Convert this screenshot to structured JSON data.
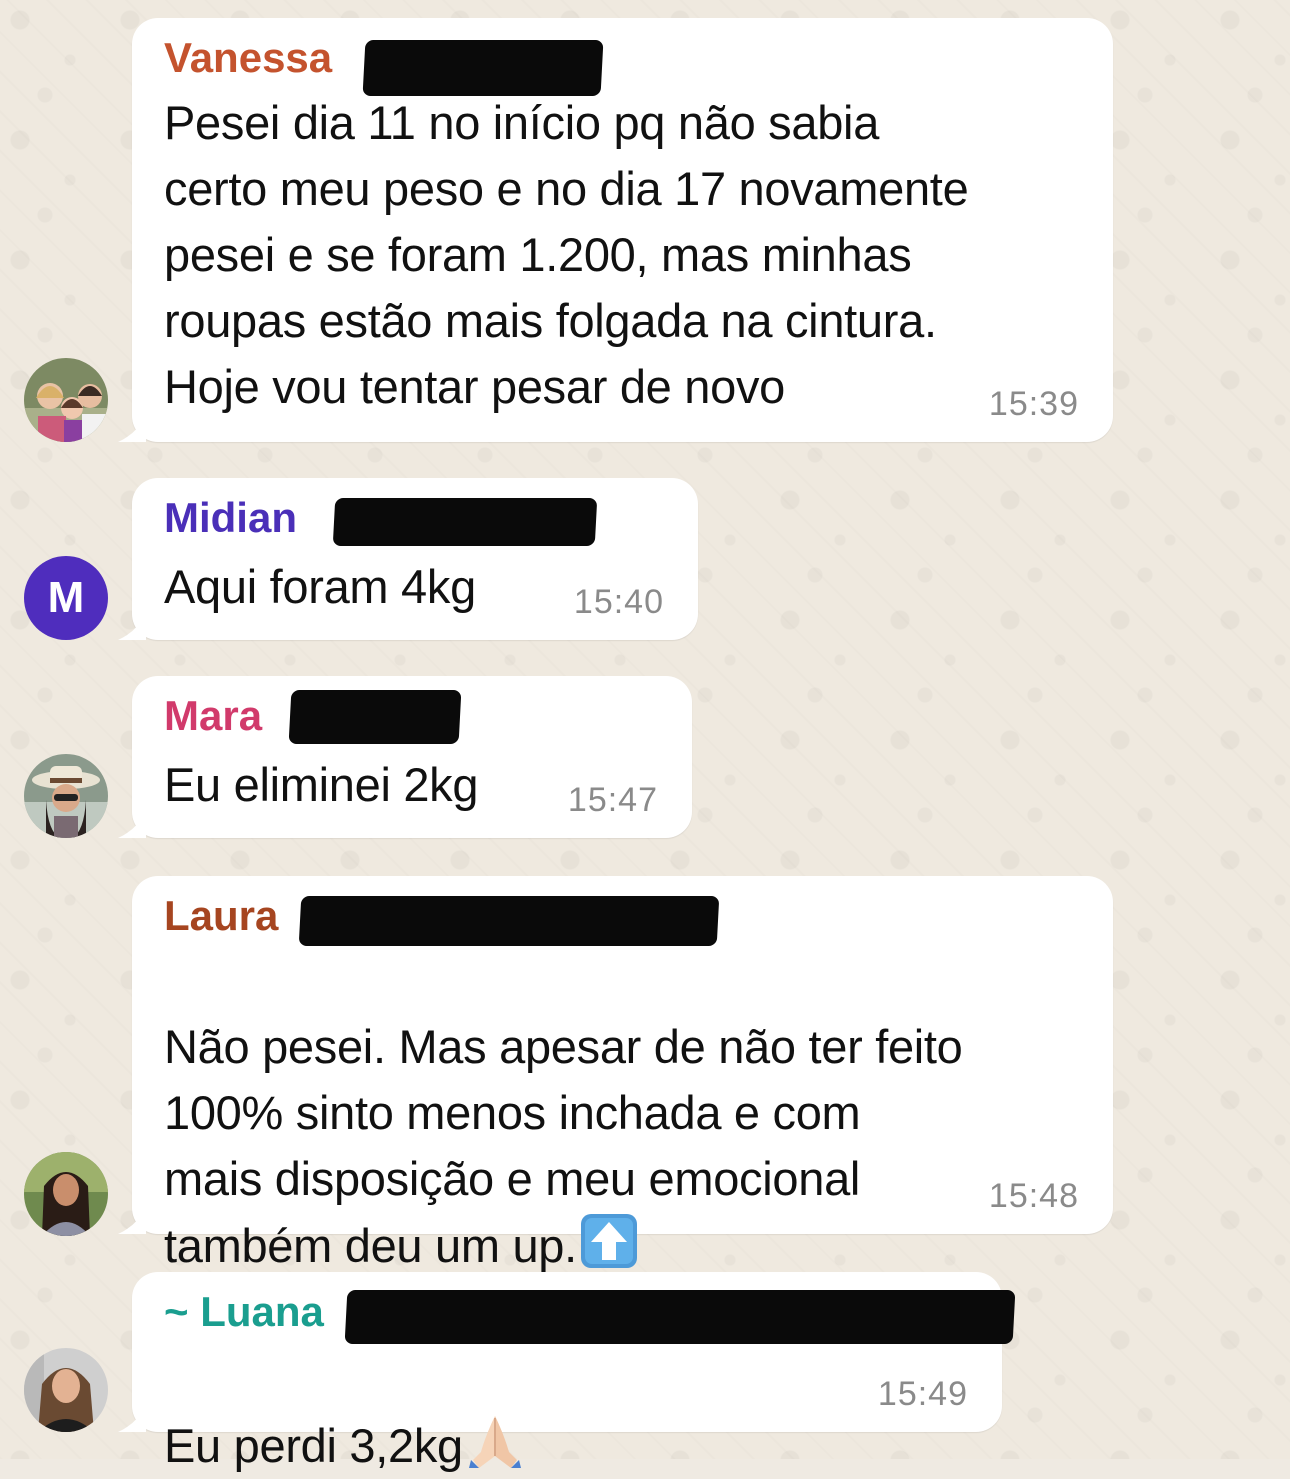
{
  "chat": {
    "messages": [
      {
        "sender": "Vanessa",
        "sender_color": "#c4532e",
        "text": "Pesei dia 11 no início pq não sabia\ncerto meu peso e no dia 17 novamente\npesei e se foram 1.200, mas minhas\nroupas estão mais folgada na cintura.\nHoje vou tentar pesar de novo",
        "time": "15:39",
        "avatar": "photo-avatar"
      },
      {
        "sender": "Midian",
        "sender_color": "#4a2fb8",
        "text": "Aqui foram 4kg",
        "time": "15:40",
        "avatar_letter": "M",
        "avatar_color": "#4f2dbd"
      },
      {
        "sender": "Mara",
        "sender_color": "#d13a6b",
        "text": "Eu eliminei 2kg",
        "time": "15:47",
        "avatar": "photo-avatar"
      },
      {
        "sender": "Laura",
        "sender_color": "#a64520",
        "text": "Não pesei. Mas apesar de não ter feito\n100% sinto menos inchada e com\nmais disposição e meu emocional\ntambém deu um up.",
        "emoji": "up-arrow-emoji",
        "time": "15:48",
        "avatar": "photo-avatar"
      },
      {
        "sender": "~ Luana",
        "sender_color": "#1a9e8f",
        "text": "Eu perdi 3,2kg",
        "emoji": "praying-hands-emoji",
        "time": "15:49",
        "avatar": "photo-avatar"
      }
    ]
  },
  "colors": {
    "background": "#efe9df",
    "bubble": "#ffffff",
    "redaction": "#0a0a0a",
    "time_text": "#8a8a8a"
  }
}
